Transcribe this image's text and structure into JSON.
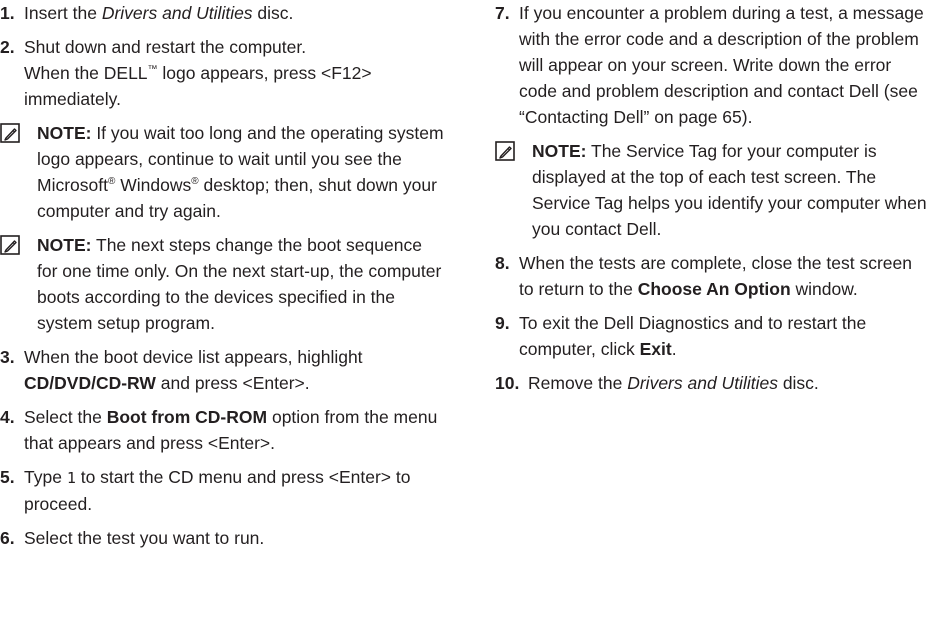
{
  "note_label": "NOTE:",
  "left": {
    "s1": {
      "num": "1.",
      "a": "Insert the ",
      "em": "Drivers and Utilities",
      "b": " disc."
    },
    "s2": {
      "num": "2.",
      "l1": "Shut down and restart the computer.",
      "l2a": "When the DELL",
      "tm": "™",
      "l2b": " logo appears, press <F12>",
      "l3": "immediately."
    },
    "note1": {
      "a": " If you wait too long and the operating system logo appears, continue to wait until you see the Microsoft",
      "reg1": "®",
      "b": " Windows",
      "reg2": "®",
      "c": " desktop; then, shut down your computer and try again."
    },
    "note2": {
      "text": " The next steps change the boot sequence for one time only. On the next start-up, the computer boots according to the devices specified in the system setup program."
    },
    "s3": {
      "num": "3.",
      "a": "When the boot device list appears, highlight ",
      "bold": "CD/DVD/CD-RW",
      "b": " and press <Enter>."
    },
    "s4": {
      "num": "4.",
      "a": "Select the ",
      "bold": "Boot from CD-ROM",
      "b": " option from the menu that appears and press <Enter>."
    },
    "s5": {
      "num": "5.",
      "a": "Type ",
      "code": "1",
      "b": " to start the CD menu and press <Enter> to proceed."
    },
    "s6": {
      "num": "6.",
      "text": "Select the test you want to run."
    }
  },
  "right": {
    "s7": {
      "num": "7.",
      "text": "If you encounter a problem during a test, a message with the error code and a description of the problem will appear on your screen. Write down the error code and problem description and contact Dell (see “Contacting Dell” on page 65)."
    },
    "note3": {
      "text": " The Service Tag for your computer is displayed at the top of each test screen. The Service Tag helps you identify your computer when you contact Dell."
    },
    "s8": {
      "num": "8.",
      "a": "When the tests are complete, close the test screen to return to the ",
      "bold": "Choose An Option",
      "b": " window."
    },
    "s9": {
      "num": "9.",
      "a": "To exit the Dell Diagnostics and to restart the computer, click ",
      "bold": "Exit",
      "b": "."
    },
    "s10": {
      "num": "10.",
      "a": "Remove the ",
      "em": "Drivers and Utilities",
      "b": " disc."
    }
  }
}
